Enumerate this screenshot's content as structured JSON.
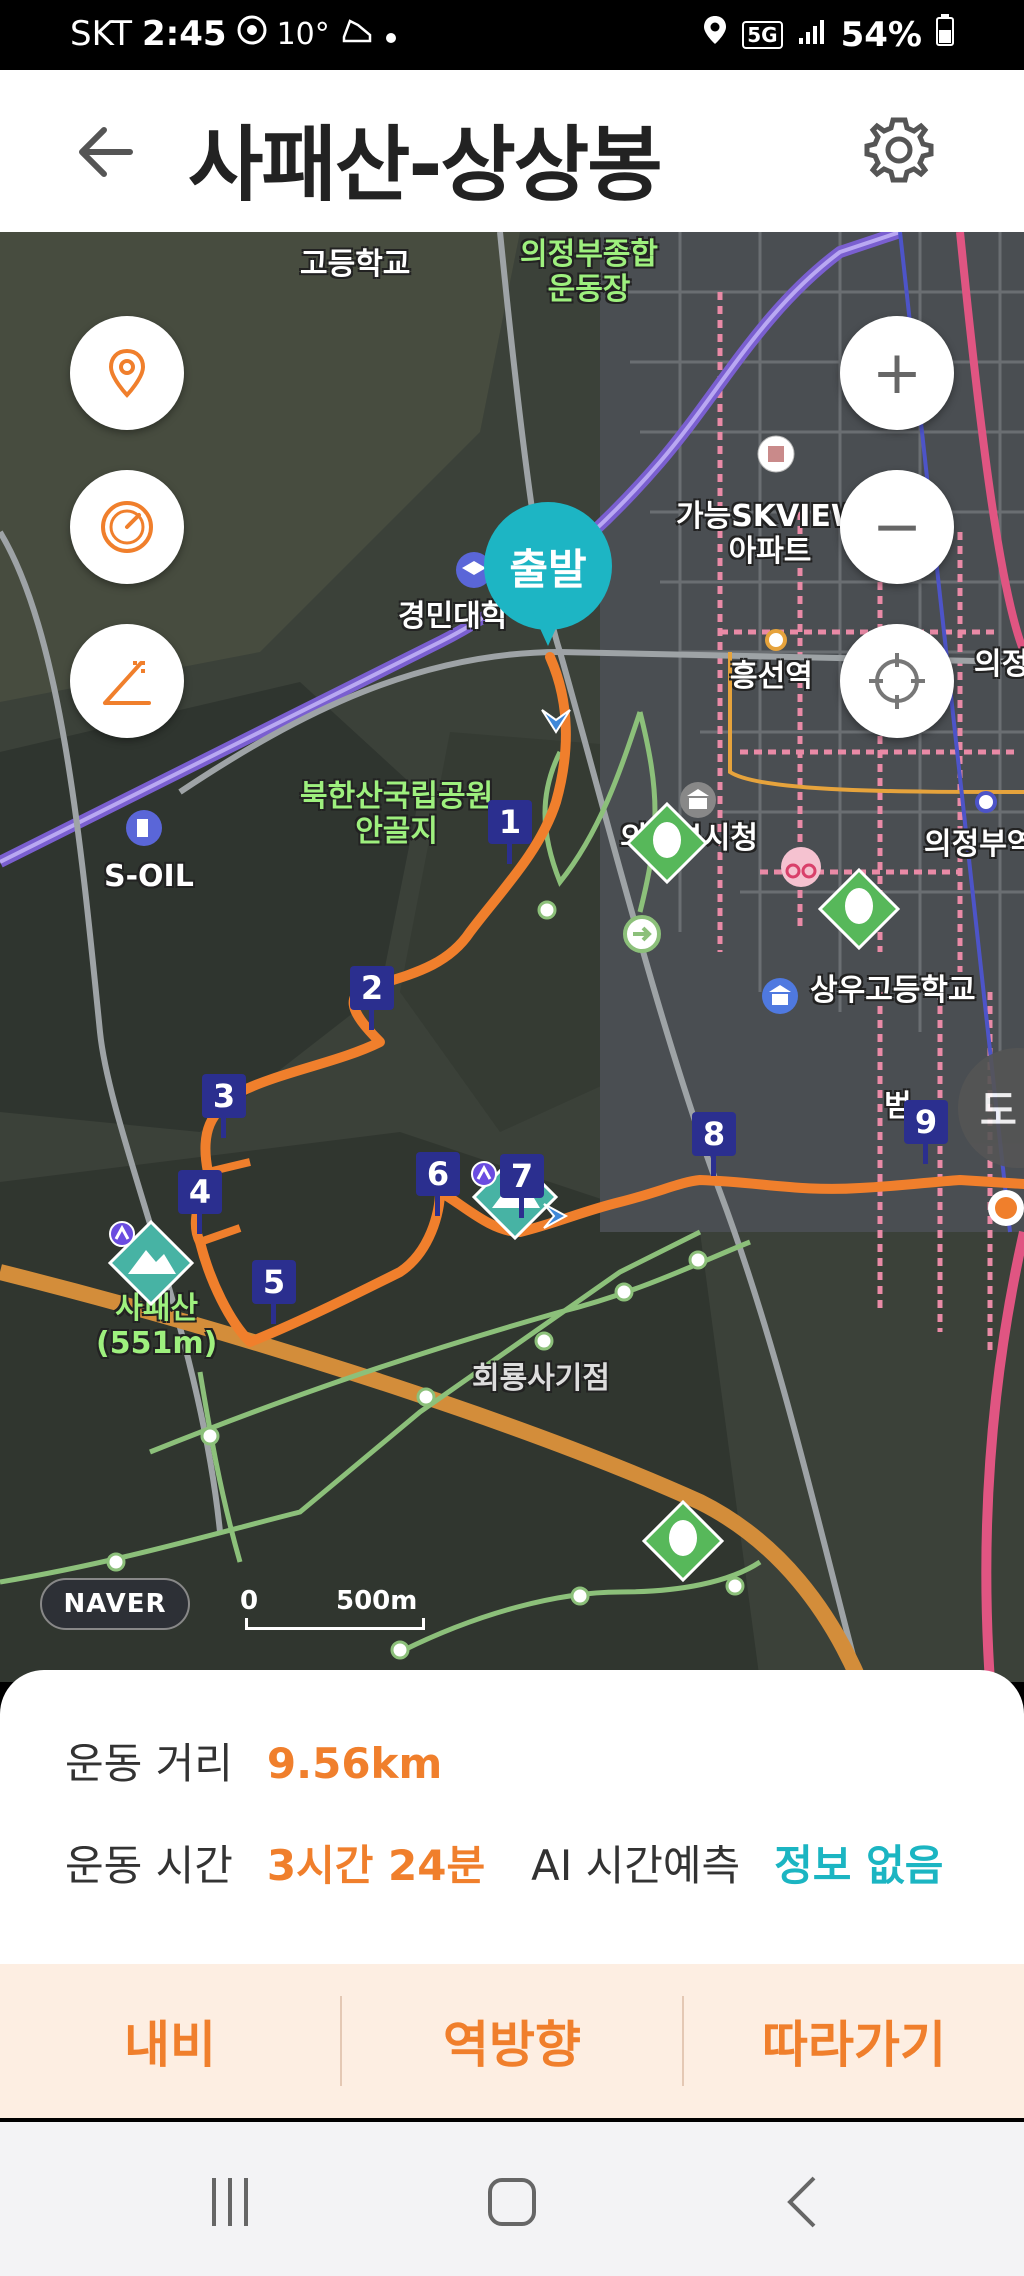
{
  "status_bar": {
    "carrier": "SKT",
    "time": "2:45",
    "temperature": "10°",
    "network": "5G",
    "battery": "54%"
  },
  "header": {
    "title": "사패산-상상봉",
    "back_icon": "arrow-left-icon",
    "settings_icon": "gear-icon"
  },
  "map": {
    "start_label": "출발",
    "waypoints": [
      "1",
      "2",
      "3",
      "4",
      "5",
      "6",
      "7",
      "8",
      "9"
    ],
    "labels": {
      "school_top": "고등학교",
      "sports_complex": "의정부종합\n운동장",
      "apartment": "가능SKVIEW\n아파트",
      "university": "경민대학",
      "station_heungseon": "흥선역",
      "national_park": "북한산국립공원\n안골지",
      "city_hall": "의정부시청",
      "soil": "S-OIL",
      "sangwoo_school": "상우고등학교",
      "station_right": "의정",
      "station_right2": "의정부역",
      "mountain": "사패산\n(551m)",
      "temple": "회룡사기점",
      "right_edge": "범"
    },
    "side_buttons": [
      "location-pin-icon",
      "speedometer-icon",
      "elevation-icon"
    ],
    "zoom_in": "+",
    "zoom_out": "−",
    "locate_icon": "crosshair-icon",
    "arrival_label": "도",
    "logo": "NAVER",
    "scale_start": "0",
    "scale_end": "500m"
  },
  "stats": {
    "distance_label": "운동 거리",
    "distance_value": "9.56km",
    "time_label": "운동 시간",
    "time_value": "3시간 24분",
    "ai_label": "AI 시간예측",
    "ai_value": "정보 없음"
  },
  "actions": {
    "navi": "내비",
    "reverse": "역방향",
    "follow": "따라가기"
  },
  "colors": {
    "route": "#f07f2c",
    "accent_teal": "#1db5c4",
    "waypoint": "#2b2f8f"
  }
}
